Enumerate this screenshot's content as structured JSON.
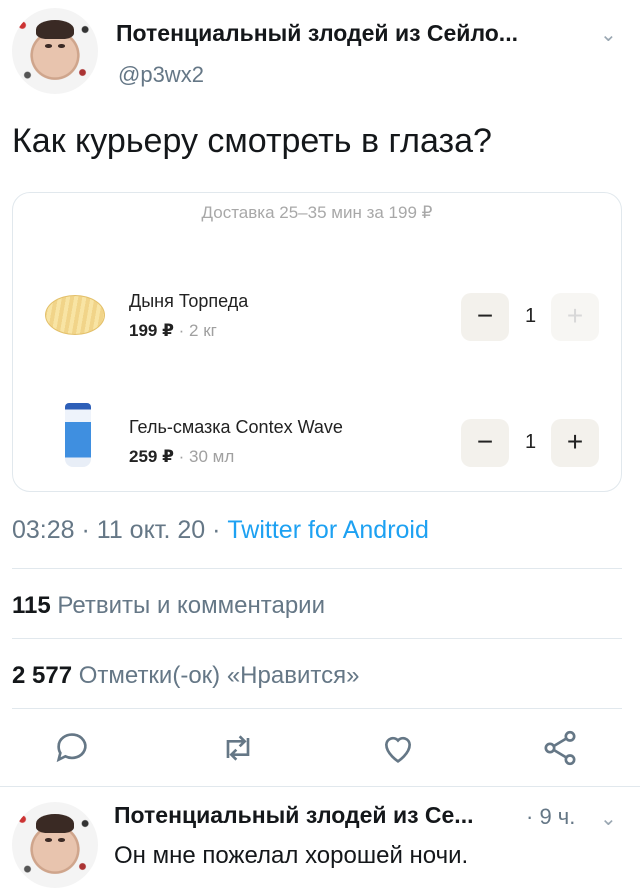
{
  "tweet": {
    "author_name": "Потенциальный злодей из Сейло...",
    "handle": "@p3wx2",
    "text": "Как курьеру смотреть в глаза?",
    "time_date": "03:28 · 11 окт. 20 · ",
    "client": "Twitter for Android"
  },
  "card": {
    "delivery": "Доставка 25–35 мин за 199 ₽",
    "items": [
      {
        "title": "Дыня Торпеда",
        "price": "199 ₽",
        "meta": " · 2 кг",
        "qty": "1",
        "minus": "−",
        "plus": "+",
        "image_icon": "melon-icon"
      },
      {
        "title": "Гель-смазка Contex Wave",
        "price": "259 ₽",
        "meta": " · 30 мл",
        "qty": "1",
        "minus": "−",
        "plus": "+",
        "image_icon": "tube-icon"
      }
    ]
  },
  "stats": {
    "retweets_count": "115",
    "retweets_label": " Ретвиты и комментарии",
    "likes_count": "2 577",
    "likes_label": " Отметки(-ок) «Нравится»"
  },
  "actions": [
    "reply-icon",
    "retweet-icon",
    "like-icon",
    "share-icon"
  ],
  "reply": {
    "author_name": "Потенциальный злодей из Се...",
    "time": "· 9 ч.",
    "text": "Он мне пожелал хорошей ночи."
  },
  "colors": {
    "accent": "#1da1f2",
    "secondary_text": "#657786",
    "divider": "#e1e8ed"
  }
}
